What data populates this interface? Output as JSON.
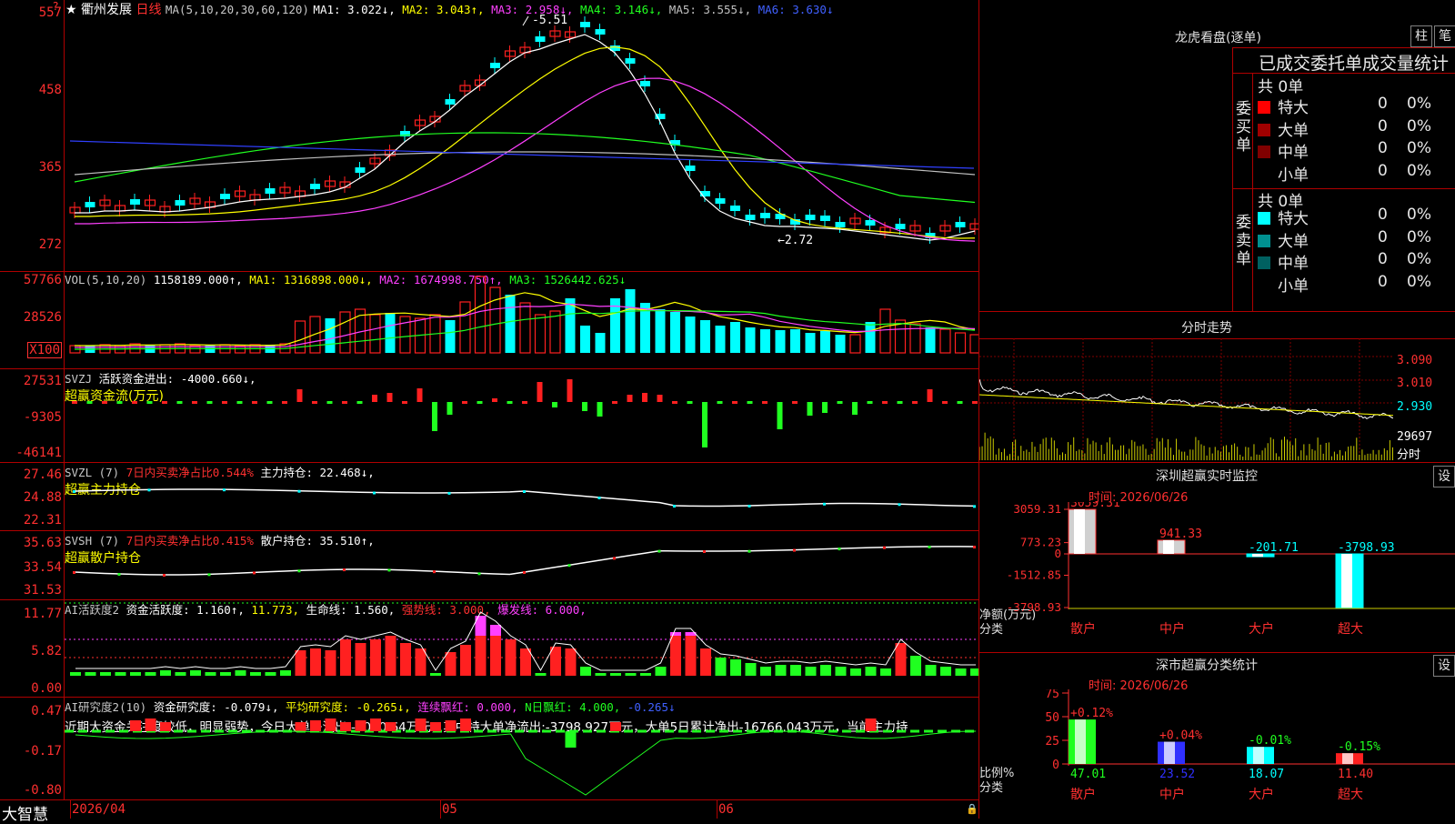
{
  "stock": {
    "name": "衢州发展",
    "period": "日线"
  },
  "main_axis": [
    "557",
    "458",
    "365",
    "272"
  ],
  "ma_legend": {
    "head": "MA(5,10,20,30,60,120)",
    "items": [
      {
        "label": "MA1: 3.022↓,",
        "color": "#ffffff"
      },
      {
        "label": "MA2: 3.043↑,",
        "color": "#ffff00"
      },
      {
        "label": "MA3: 2.958↓,",
        "color": "#ff40ff"
      },
      {
        "label": "MA4: 3.146↓,",
        "color": "#20ff20"
      },
      {
        "label": "MA5: 3.555↓,",
        "color": "#c0c0c0"
      },
      {
        "label": "MA6: 3.630↓",
        "color": "#4060ff"
      }
    ]
  },
  "price_marks": {
    "high": "5.51",
    "low": "2.72"
  },
  "vol": {
    "axis": [
      "57766",
      "28526",
      "X100"
    ],
    "head": "VOL(5,10,20)",
    "items": [
      {
        "label": "1158189.000↑,",
        "color": "#ffffff"
      },
      {
        "label": "MA1: 1316898.000↓,",
        "color": "#ffff00"
      },
      {
        "label": "MA2: 1674998.750↑,",
        "color": "#ff40ff"
      },
      {
        "label": "MA3: 1526442.625↓",
        "color": "#20ff20"
      }
    ]
  },
  "svzj": {
    "axis": [
      "27531",
      "-9305",
      "-46141"
    ],
    "head": "SVZJ",
    "line1": "活跃资金进出: -4000.660↓,",
    "line2": "超赢资金流(万元)"
  },
  "svzl": {
    "axis": [
      "27.46",
      "24.88",
      "22.31"
    ],
    "head": "SVZL (7)",
    "red": "7日内买卖净占比0.544%",
    "white": "主力持仓: 22.468↓,",
    "line2": "超赢主力持仓"
  },
  "svsh": {
    "axis": [
      "35.63",
      "33.54",
      "31.53"
    ],
    "head": "SVSH (7)",
    "red": "7日内买卖净占比0.415%",
    "white": "散户持仓: 35.510↑,",
    "line2": "超赢散户持仓"
  },
  "ai1": {
    "axis": [
      "11.77",
      "5.82",
      "0.00"
    ],
    "head": "AI活跃度2",
    "w1": "资金活跃度: 1.160↑,",
    "y1": "11.773,",
    "w2": "生命线: 1.560,",
    "r1": "强势线: 3.000,",
    "m1": "爆发线: 6.000,"
  },
  "ai2": {
    "axis": [
      "0.47",
      "-0.17",
      "-0.80"
    ],
    "head": "AI研究度2(10)",
    "w1": "资金研究度: -0.079↓,",
    "y1": "平均研究度: -0.265↓,",
    "m1": "连续飘红: 0.000,",
    "g1": "N日飘红: 4.000,",
    "b1": "-0.265↓",
    "note": "近期大资金关注度较低，明显弱势，今日大单净流出:-4000.64万元，其中特大单净流出:-3798.927万元，大单5日累计净出-16766.043万元，当前主力持"
  },
  "dates": [
    "2026/04",
    "05",
    "06"
  ],
  "brand": "大智慧",
  "dragon": {
    "title": "龙虎看盘(逐单)",
    "btn1": "柱",
    "btn2": "笔",
    "sub": "已成交委托单成交量统计",
    "buy_label": "委买单",
    "sell_label": "委卖单",
    "buy_total": "共 0单",
    "sell_total": "共 0单",
    "buy_rows": [
      {
        "name": "特大",
        "n": "0",
        "p": "0%",
        "color": "#ff0000"
      },
      {
        "name": "大单",
        "n": "0",
        "p": "0%",
        "color": "#a00000"
      },
      {
        "name": "中单",
        "n": "0",
        "p": "0%",
        "color": "#800000"
      },
      {
        "name": "小单",
        "n": "0",
        "p": "0%",
        "color": ""
      }
    ],
    "sell_rows": [
      {
        "name": "特大",
        "n": "0",
        "p": "0%",
        "color": "#00ffff"
      },
      {
        "name": "大单",
        "n": "0",
        "p": "0%",
        "color": "#009090"
      },
      {
        "name": "中单",
        "n": "0",
        "p": "0%",
        "color": "#006060"
      },
      {
        "name": "小单",
        "n": "0",
        "p": "0%",
        "color": ""
      }
    ]
  },
  "intraday": {
    "title": "分时走势",
    "axis": [
      "3.090",
      "3.010",
      "2.930"
    ],
    "vol": "29697",
    "vol_unit": "分时"
  },
  "sz_monitor": {
    "title": "深圳超赢实时监控",
    "btn": "设",
    "time": "时间: 2026/06/26",
    "axis": [
      "3059.31",
      "773.23",
      "0",
      "-1512.85",
      "-3798.93"
    ],
    "ylab1": "净额(万元)",
    "ylab2": "分类",
    "bars": [
      {
        "cat": "散户",
        "val": 3059.31,
        "label": "3059.31"
      },
      {
        "cat": "中户",
        "val": 941.33,
        "label": "941.33"
      },
      {
        "cat": "大户",
        "val": -201.71,
        "label": "-201.71"
      },
      {
        "cat": "超大",
        "val": -3798.93,
        "label": "-3798.93"
      }
    ]
  },
  "sz_class": {
    "title": "深市超赢分类统计",
    "btn": "设",
    "time": "时间: 2026/06/26",
    "axis": [
      "75",
      "50",
      "25",
      "0"
    ],
    "ylab1": "比例%",
    "ylab2": "分类",
    "bars": [
      {
        "cat": "散户",
        "val": 47.01,
        "label": "47.01",
        "chg": "+0.12%"
      },
      {
        "cat": "中户",
        "val": 23.52,
        "label": "23.52",
        "chg": "+0.04%"
      },
      {
        "cat": "大户",
        "val": 18.07,
        "label": "18.07",
        "chg": "-0.01%"
      },
      {
        "cat": "超大",
        "val": 11.4,
        "label": "11.40",
        "chg": "-0.15%"
      }
    ]
  }
}
